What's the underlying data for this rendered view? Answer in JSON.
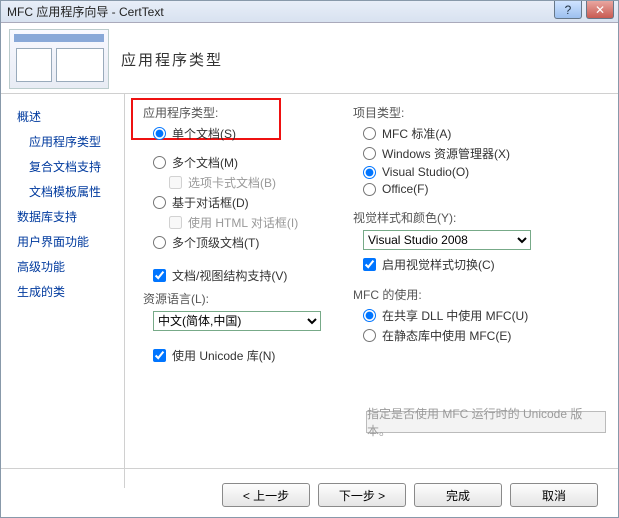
{
  "window": {
    "title": "MFC 应用程序向导 - CertText"
  },
  "header": {
    "heading": "应用程序类型"
  },
  "sidebar": {
    "items": [
      {
        "label": "概述"
      },
      {
        "label": "应用程序类型"
      },
      {
        "label": "复合文档支持"
      },
      {
        "label": "文档模板属性"
      },
      {
        "label": "数据库支持"
      },
      {
        "label": "用户界面功能"
      },
      {
        "label": "高级功能"
      },
      {
        "label": "生成的类"
      }
    ]
  },
  "app_type": {
    "legend": "应用程序类型:",
    "single_doc": "单个文档(S)",
    "multi_doc": "多个文档(M)",
    "tabbed_doc": "选项卡式文档(B)",
    "dialog_based": "基于对话框(D)",
    "use_html_dlg": "使用 HTML 对话框(I)",
    "multi_top": "多个顶级文档(T)",
    "doc_view": "文档/视图结构支持(V)",
    "resource_lang_label": "资源语言(L):",
    "resource_lang_value": "中文(简体,中国)",
    "use_unicode": "使用 Unicode 库(N)"
  },
  "project_type": {
    "legend": "项目类型:",
    "mfc_std": "MFC 标准(A)",
    "explorer": "Windows 资源管理器(X)",
    "visual_studio": "Visual Studio(O)",
    "office": "Office(F)"
  },
  "visual_style": {
    "legend": "视觉样式和颜色(Y):",
    "value": "Visual Studio 2008",
    "enable_switch": "启用视觉样式切换(C)"
  },
  "mfc_use": {
    "legend": "MFC 的使用:",
    "shared_dll": "在共享 DLL 中使用 MFC(U)",
    "static_lib": "在静态库中使用 MFC(E)"
  },
  "hint": "指定是否使用 MFC 运行时的 Unicode 版本。",
  "buttons": {
    "prev": "< 上一步",
    "next": "下一步 >",
    "finish": "完成",
    "cancel": "取消"
  }
}
